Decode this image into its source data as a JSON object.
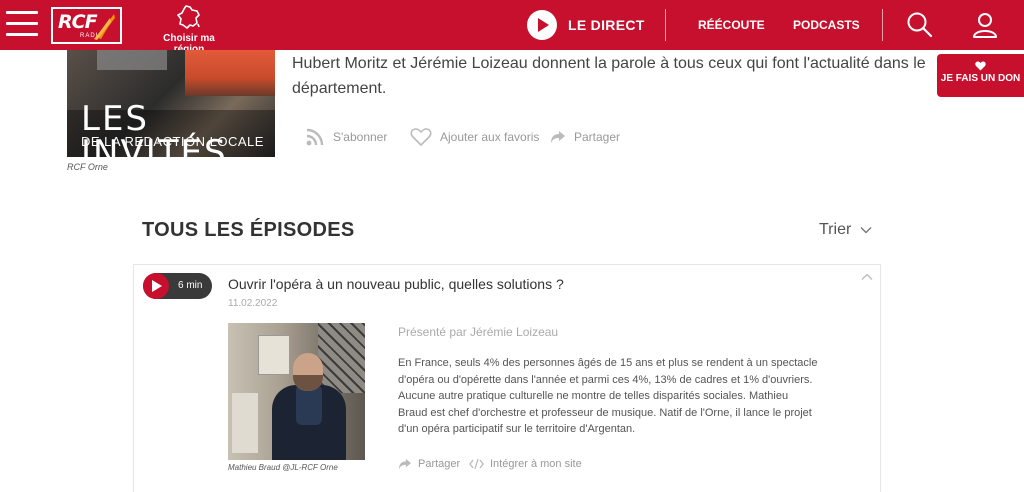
{
  "header": {
    "logo_text": "RCF",
    "logo_sub": "RADIO",
    "region_label": "Choisir ma région",
    "live_label": "LE DIRECT",
    "nav": [
      "RÉÉCOUTE",
      "PODCASTS"
    ]
  },
  "show": {
    "cover_title_line1": "LES INVITÉS",
    "cover_title_line2": "DE LA REDACTION LOCALE",
    "cover_caption": "RCF Orne",
    "description": "Hubert Moritz et Jérémie Loizeau donnent la parole à tous ceux qui font l'actualité dans le département.",
    "actions": {
      "subscribe": "S'abonner",
      "favorite": "Ajouter aux favoris",
      "share": "Partager"
    }
  },
  "donate": {
    "label": "JE FAIS UN DON"
  },
  "episodes": {
    "heading": "TOUS LES ÉPISODES",
    "sort_label": "Trier",
    "items": [
      {
        "duration": "6 min",
        "title": "Ouvrir l'opéra à un nouveau public, quelles solutions ?",
        "date": "11.02.2022",
        "presenter": "Présenté par Jérémie Loizeau",
        "summary": "En France, seuls 4% des personnes âgés de 15 ans et plus se rendent à un spectacle d'opéra ou d'opérette dans l'année et parmi ces 4%, 13% de cadres et 1% d'ouvriers. Aucune autre pratique culturelle ne montre de telles disparités sociales. Mathieu Braud est chef d'orchestre et professeur de musique. Natif de l'Orne, il lance le projet d'un opéra participatif sur le territoire d'Argentan.",
        "photo_caption": "Mathieu Braud @JL-RCF Orne",
        "share_label": "Partager",
        "embed_label": "Intégrer à mon site"
      }
    ]
  },
  "colors": {
    "brand": "#c6102e",
    "dark_pill": "#3a3a3a"
  },
  "icons": [
    "menu-icon",
    "france-map-icon",
    "play-icon",
    "search-icon",
    "user-icon",
    "rss-icon",
    "heart-icon",
    "share-icon",
    "chevron-down-icon",
    "chevron-up-icon",
    "code-icon"
  ]
}
